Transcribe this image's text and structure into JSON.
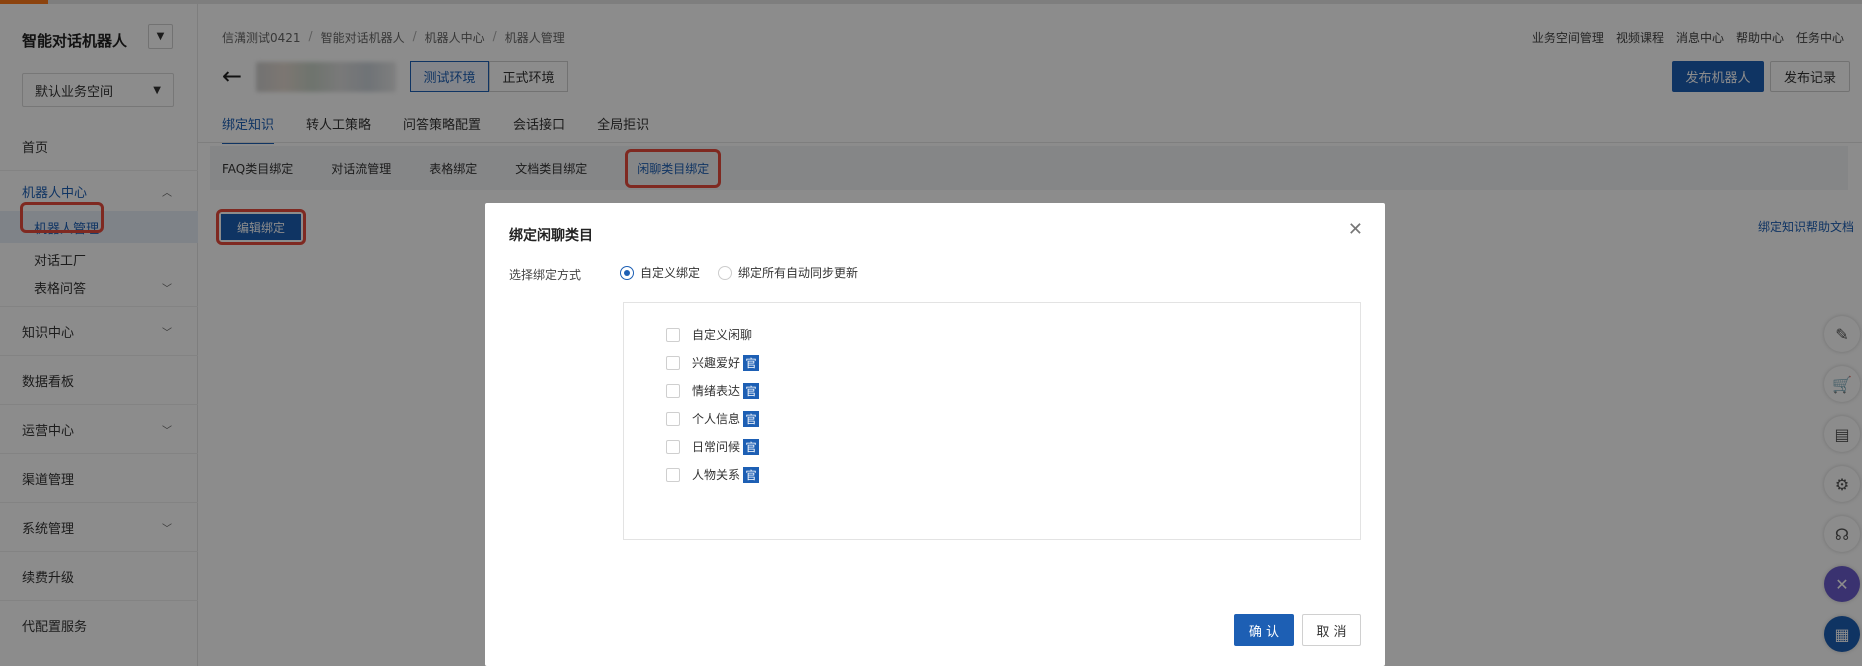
{
  "sidebar": {
    "brand": "智能对话机器人",
    "workspace": "默认业务空间",
    "items": [
      {
        "label": "首页"
      },
      {
        "label": "机器人中心"
      },
      {
        "label": "机器人管理"
      },
      {
        "label": "对话工厂"
      },
      {
        "label": "表格问答"
      },
      {
        "label": "知识中心"
      },
      {
        "label": "数据看板"
      },
      {
        "label": "运营中心"
      },
      {
        "label": "渠道管理"
      },
      {
        "label": "系统管理"
      },
      {
        "label": "续费升级"
      },
      {
        "label": "代配置服务"
      }
    ]
  },
  "breadcrumb": [
    "信澫测试0421",
    "智能对话机器人",
    "机器人中心",
    "机器人管理"
  ],
  "toplinks": [
    "业务空间管理",
    "视频课程",
    "消息中心",
    "帮助中心",
    "任务中心"
  ],
  "env": {
    "test": "测试环境",
    "prod": "正式环境"
  },
  "actions": {
    "publish": "发布机器人",
    "record": "发布记录"
  },
  "tabs1": [
    "绑定知识",
    "转人工策略",
    "问答策略配置",
    "会话接口",
    "全局拒识"
  ],
  "tabs2": [
    "FAQ类目绑定",
    "对话流管理",
    "表格绑定",
    "文档类目绑定",
    "闲聊类目绑定"
  ],
  "edit_bind": "编辑绑定",
  "help_doc": "绑定知识帮助文档",
  "modal": {
    "title": "绑定闲聊类目",
    "bind_label": "选择绑定方式",
    "radio_custom": "自定义绑定",
    "radio_all": "绑定所有自动同步更新",
    "categories": [
      {
        "label": "自定义闲聊",
        "official": ""
      },
      {
        "label": "兴趣爱好",
        "official": "官"
      },
      {
        "label": "情绪表达",
        "official": "官"
      },
      {
        "label": "个人信息",
        "official": "官"
      },
      {
        "label": "日常问候",
        "official": "官"
      },
      {
        "label": "人物关系",
        "official": "官"
      }
    ],
    "confirm": "确 认",
    "cancel": "取 消"
  }
}
